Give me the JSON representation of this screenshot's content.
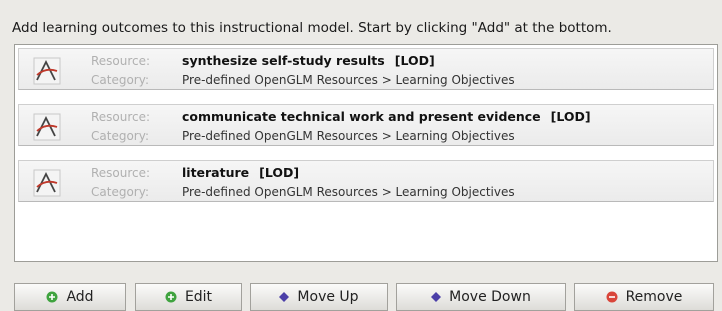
{
  "instruction": "Add learning outcomes to this instructional model. Start by clicking \"Add\" at the bottom.",
  "labels": {
    "resource": "Resource:",
    "category": "Category:"
  },
  "items": [
    {
      "resource": "synthesize self-study results",
      "tag": "[LOD]",
      "category": "Pre-defined OpenGLM Resources > Learning Objectives"
    },
    {
      "resource": "communicate technical work and present evidence",
      "tag": "[LOD]",
      "category": "Pre-defined OpenGLM Resources > Learning Objectives"
    },
    {
      "resource": "literature",
      "tag": "[LOD]",
      "category": "Pre-defined OpenGLM Resources > Learning Objectives"
    }
  ],
  "buttons": {
    "add": {
      "label": "Add",
      "icon": "plus-circle-icon",
      "color": "#3fa33f"
    },
    "edit": {
      "label": "Edit",
      "icon": "plus-circle-icon",
      "color": "#3fa33f"
    },
    "move_up": {
      "label": "Move Up",
      "icon": "diamond-icon",
      "color": "#4b3fa8"
    },
    "move_down": {
      "label": "Move Down",
      "icon": "diamond-icon",
      "color": "#4b3fa8"
    },
    "remove": {
      "label": "Remove",
      "icon": "minus-circle-icon",
      "color": "#d9453a"
    }
  }
}
